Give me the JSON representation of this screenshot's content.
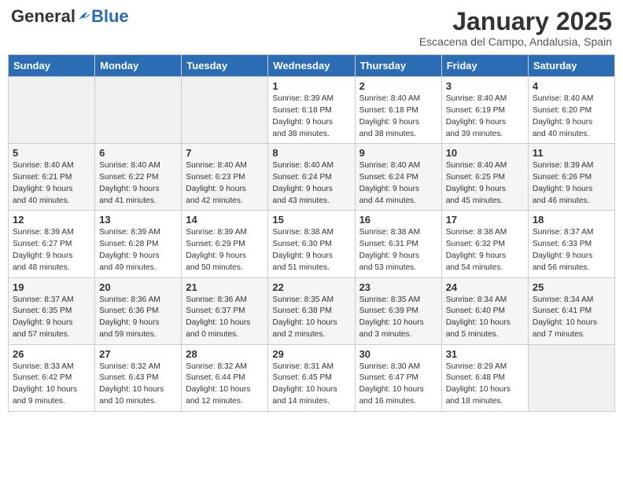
{
  "header": {
    "logo_general": "General",
    "logo_blue": "Blue",
    "month_year": "January 2025",
    "location": "Escacena del Campo, Andalusia, Spain"
  },
  "weekdays": [
    "Sunday",
    "Monday",
    "Tuesday",
    "Wednesday",
    "Thursday",
    "Friday",
    "Saturday"
  ],
  "weeks": [
    [
      {
        "day": "",
        "info": ""
      },
      {
        "day": "",
        "info": ""
      },
      {
        "day": "",
        "info": ""
      },
      {
        "day": "1",
        "info": "Sunrise: 8:39 AM\nSunset: 6:18 PM\nDaylight: 9 hours\nand 38 minutes."
      },
      {
        "day": "2",
        "info": "Sunrise: 8:40 AM\nSunset: 6:18 PM\nDaylight: 9 hours\nand 38 minutes."
      },
      {
        "day": "3",
        "info": "Sunrise: 8:40 AM\nSunset: 6:19 PM\nDaylight: 9 hours\nand 39 minutes."
      },
      {
        "day": "4",
        "info": "Sunrise: 8:40 AM\nSunset: 6:20 PM\nDaylight: 9 hours\nand 40 minutes."
      }
    ],
    [
      {
        "day": "5",
        "info": "Sunrise: 8:40 AM\nSunset: 6:21 PM\nDaylight: 9 hours\nand 40 minutes."
      },
      {
        "day": "6",
        "info": "Sunrise: 8:40 AM\nSunset: 6:22 PM\nDaylight: 9 hours\nand 41 minutes."
      },
      {
        "day": "7",
        "info": "Sunrise: 8:40 AM\nSunset: 6:23 PM\nDaylight: 9 hours\nand 42 minutes."
      },
      {
        "day": "8",
        "info": "Sunrise: 8:40 AM\nSunset: 6:24 PM\nDaylight: 9 hours\nand 43 minutes."
      },
      {
        "day": "9",
        "info": "Sunrise: 8:40 AM\nSunset: 6:24 PM\nDaylight: 9 hours\nand 44 minutes."
      },
      {
        "day": "10",
        "info": "Sunrise: 8:40 AM\nSunset: 6:25 PM\nDaylight: 9 hours\nand 45 minutes."
      },
      {
        "day": "11",
        "info": "Sunrise: 8:39 AM\nSunset: 6:26 PM\nDaylight: 9 hours\nand 46 minutes."
      }
    ],
    [
      {
        "day": "12",
        "info": "Sunrise: 8:39 AM\nSunset: 6:27 PM\nDaylight: 9 hours\nand 48 minutes."
      },
      {
        "day": "13",
        "info": "Sunrise: 8:39 AM\nSunset: 6:28 PM\nDaylight: 9 hours\nand 49 minutes."
      },
      {
        "day": "14",
        "info": "Sunrise: 8:39 AM\nSunset: 6:29 PM\nDaylight: 9 hours\nand 50 minutes."
      },
      {
        "day": "15",
        "info": "Sunrise: 8:38 AM\nSunset: 6:30 PM\nDaylight: 9 hours\nand 51 minutes."
      },
      {
        "day": "16",
        "info": "Sunrise: 8:38 AM\nSunset: 6:31 PM\nDaylight: 9 hours\nand 53 minutes."
      },
      {
        "day": "17",
        "info": "Sunrise: 8:38 AM\nSunset: 6:32 PM\nDaylight: 9 hours\nand 54 minutes."
      },
      {
        "day": "18",
        "info": "Sunrise: 8:37 AM\nSunset: 6:33 PM\nDaylight: 9 hours\nand 56 minutes."
      }
    ],
    [
      {
        "day": "19",
        "info": "Sunrise: 8:37 AM\nSunset: 6:35 PM\nDaylight: 9 hours\nand 57 minutes."
      },
      {
        "day": "20",
        "info": "Sunrise: 8:36 AM\nSunset: 6:36 PM\nDaylight: 9 hours\nand 59 minutes."
      },
      {
        "day": "21",
        "info": "Sunrise: 8:36 AM\nSunset: 6:37 PM\nDaylight: 10 hours\nand 0 minutes."
      },
      {
        "day": "22",
        "info": "Sunrise: 8:35 AM\nSunset: 6:38 PM\nDaylight: 10 hours\nand 2 minutes."
      },
      {
        "day": "23",
        "info": "Sunrise: 8:35 AM\nSunset: 6:39 PM\nDaylight: 10 hours\nand 3 minutes."
      },
      {
        "day": "24",
        "info": "Sunrise: 8:34 AM\nSunset: 6:40 PM\nDaylight: 10 hours\nand 5 minutes."
      },
      {
        "day": "25",
        "info": "Sunrise: 8:34 AM\nSunset: 6:41 PM\nDaylight: 10 hours\nand 7 minutes."
      }
    ],
    [
      {
        "day": "26",
        "info": "Sunrise: 8:33 AM\nSunset: 6:42 PM\nDaylight: 10 hours\nand 9 minutes."
      },
      {
        "day": "27",
        "info": "Sunrise: 8:32 AM\nSunset: 6:43 PM\nDaylight: 10 hours\nand 10 minutes."
      },
      {
        "day": "28",
        "info": "Sunrise: 8:32 AM\nSunset: 6:44 PM\nDaylight: 10 hours\nand 12 minutes."
      },
      {
        "day": "29",
        "info": "Sunrise: 8:31 AM\nSunset: 6:45 PM\nDaylight: 10 hours\nand 14 minutes."
      },
      {
        "day": "30",
        "info": "Sunrise: 8:30 AM\nSunset: 6:47 PM\nDaylight: 10 hours\nand 16 minutes."
      },
      {
        "day": "31",
        "info": "Sunrise: 8:29 AM\nSunset: 6:48 PM\nDaylight: 10 hours\nand 18 minutes."
      },
      {
        "day": "",
        "info": ""
      }
    ]
  ]
}
